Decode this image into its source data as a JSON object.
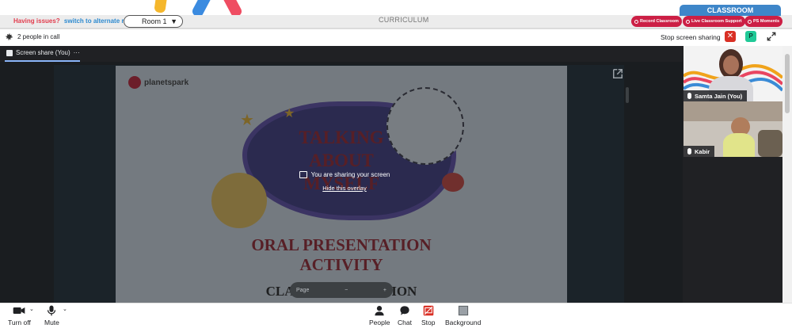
{
  "topbar": {
    "issue_text": "Having issues?",
    "alt_room": "switch to alternate room",
    "room": "Room 1",
    "curriculum": "CURRICULUM",
    "classroom": "CLASSROOM",
    "record": "Record Classroom",
    "support": "Live Classroom Support",
    "moments": "PS Moments"
  },
  "meet": {
    "people_count": "2 people in call",
    "stop_sharing": "Stop screen sharing",
    "participant_badge": "P",
    "share_tab": "Screen share (You)",
    "overlay_message": "You are sharing your screen",
    "hide_overlay": "Hide this overlay",
    "page_label": "Page"
  },
  "slide": {
    "logo": "planetspark",
    "line1": "TALKING",
    "line2": "ABOUT",
    "line3": "MYSELF",
    "line4": "ORAL PRESENTATION",
    "line5": "ACTIVITY",
    "line6": "CLASS PRESENTATION"
  },
  "participants": [
    {
      "name": "Samta Jain (You)"
    },
    {
      "name": "Kabir"
    }
  ],
  "controls": {
    "turn_off": "Turn off",
    "mute": "Mute",
    "people": "People",
    "chat": "Chat",
    "stop": "Stop",
    "background": "Background"
  },
  "colors": {
    "accent_red": "#cc1f45",
    "classroom_blue": "#3e86c9",
    "stop_red": "#d93025"
  }
}
